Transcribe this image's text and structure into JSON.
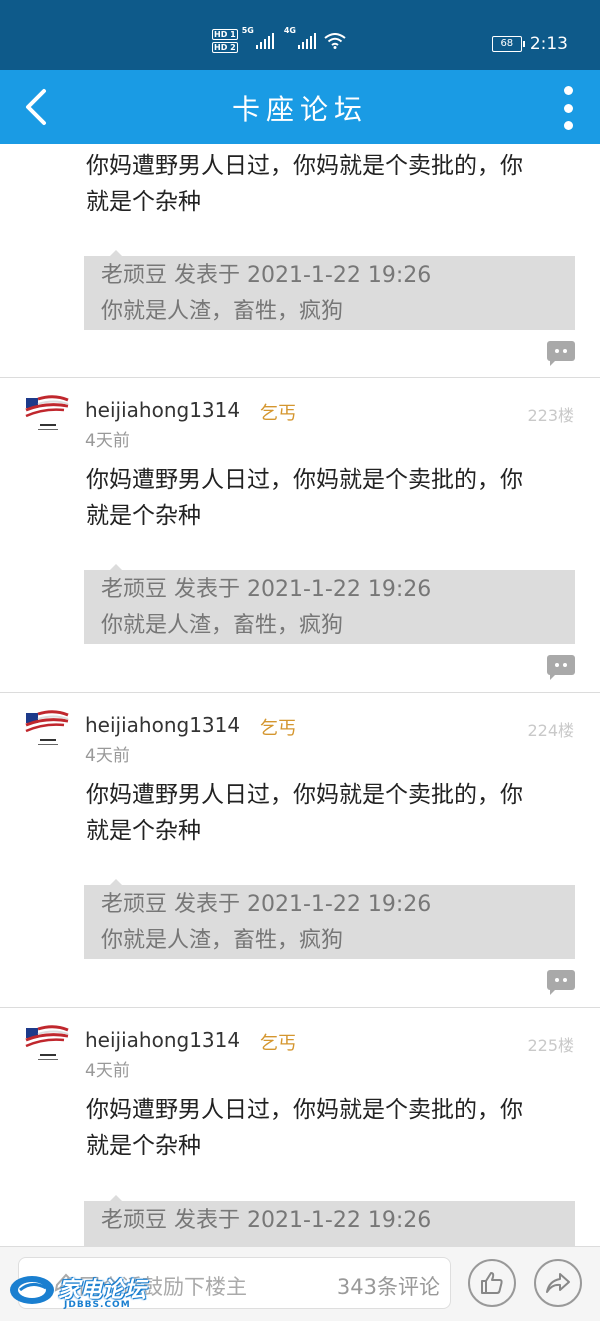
{
  "status_bar": {
    "hd1": "HD 1",
    "hd2": "HD 2",
    "net1": "5G",
    "net2": "4G",
    "battery": "68",
    "time": "2:13"
  },
  "header": {
    "title": "卡座论坛",
    "back_icon": "chevron-left-icon",
    "more_icon": "more-vertical-icon"
  },
  "posts": [
    {
      "content": "你妈遭野男人日过，你妈就是个卖批的，你就是个杂种",
      "quote_meta": "老顽豆 发表于 2021-1-22 19:26",
      "quote_text": "你就是人渣，畜牲，疯狗"
    },
    {
      "username": "heijiahong1314",
      "badge": "乞丐",
      "time": "4天前",
      "floor": "223楼",
      "content": "你妈遭野男人日过，你妈就是个卖批的，你就是个杂种",
      "quote_meta": "老顽豆 发表于 2021-1-22 19:26",
      "quote_text": "你就是人渣，畜牲，疯狗"
    },
    {
      "username": "heijiahong1314",
      "badge": "乞丐",
      "time": "4天前",
      "floor": "224楼",
      "content": "你妈遭野男人日过，你妈就是个卖批的，你就是个杂种",
      "quote_meta": "老顽豆 发表于 2021-1-22 19:26",
      "quote_text": "你就是人渣，畜牲，疯狗"
    },
    {
      "username": "heijiahong1314",
      "badge": "乞丐",
      "time": "4天前",
      "floor": "225楼",
      "content": "你妈遭野男人日过，你妈就是个卖批的，你就是个杂种",
      "quote_meta": "老顽豆 发表于 2021-1-22 19:26"
    }
  ],
  "bottom_bar": {
    "reply_placeholder": "回个话鼓励下楼主",
    "comment_count": "343条评论",
    "like_icon": "thumbs-up-icon",
    "share_icon": "share-icon"
  },
  "watermark": {
    "text": "家电论坛",
    "sub": "JDBBS.COM"
  },
  "colors": {
    "status_bar": "#0e5a8a",
    "title_bar": "#1a9be4",
    "badge": "#d4962f",
    "quote_bg": "#dcdcdc"
  }
}
